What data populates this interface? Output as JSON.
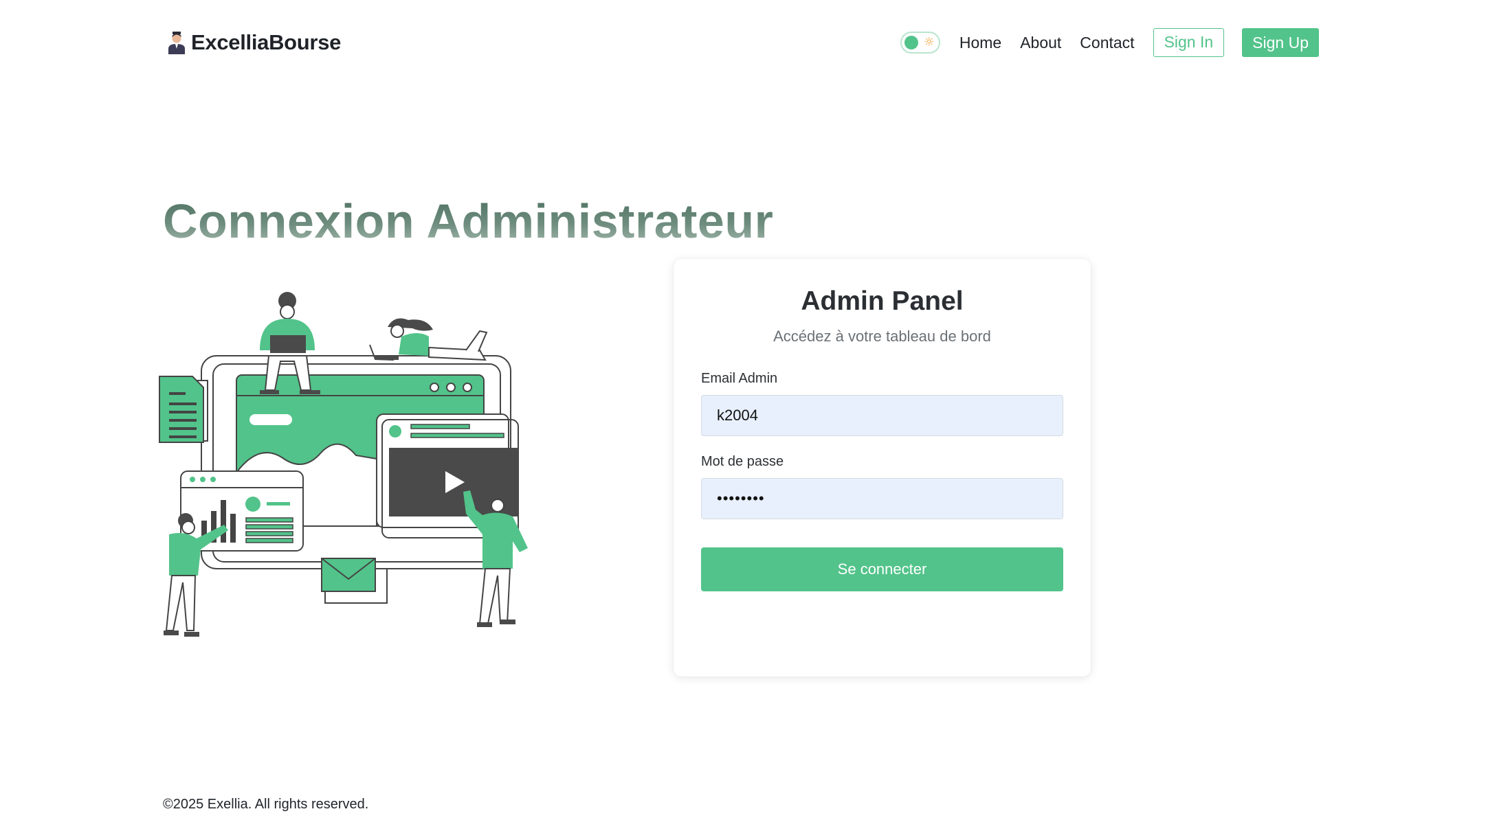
{
  "header": {
    "brand": "ExcelliaBourse",
    "nav": {
      "home": "Home",
      "about": "About",
      "contact": "Contact"
    },
    "sign_in": "Sign In",
    "sign_up": "Sign Up",
    "theme_toggle_icon": "sun-icon"
  },
  "main": {
    "title": "Connexion Administrateur"
  },
  "login_card": {
    "title": "Admin Panel",
    "subtitle": "Accédez à votre tableau de bord",
    "email_label": "Email Admin",
    "email_value": "k2004",
    "password_label": "Mot de passe",
    "password_value": "••••••••",
    "submit_label": "Se connecter"
  },
  "footer": {
    "copyright": "©2025 Exellia. All rights reserved."
  },
  "colors": {
    "accent": "#52c38a",
    "dark": "#4a4a4a",
    "input_bg": "#e8f0fd"
  }
}
